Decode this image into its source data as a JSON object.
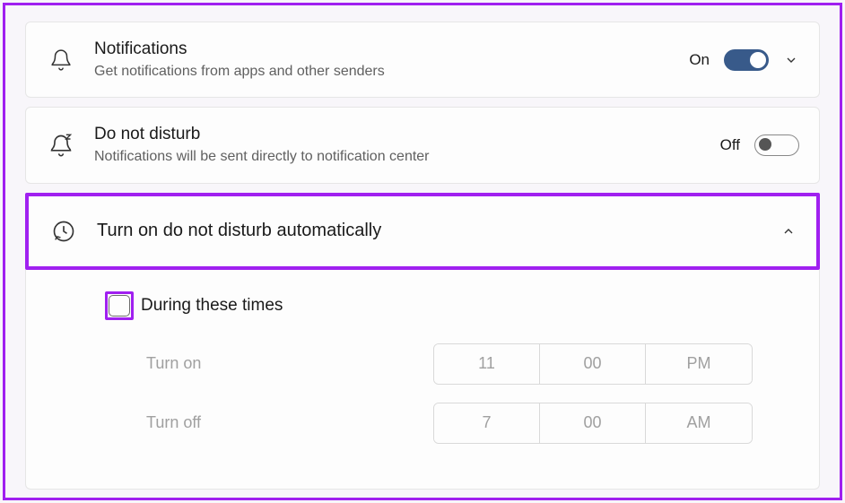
{
  "notifications": {
    "title": "Notifications",
    "subtitle": "Get notifications from apps and other senders",
    "state": "On"
  },
  "dnd": {
    "title": "Do not disturb",
    "subtitle": "Notifications will be sent directly to notification center",
    "state": "Off"
  },
  "auto_dnd": {
    "title": "Turn on do not disturb automatically",
    "during_label": "During these times",
    "turn_on": {
      "label": "Turn on",
      "hour": "11",
      "minute": "00",
      "ampm": "PM"
    },
    "turn_off": {
      "label": "Turn off",
      "hour": "7",
      "minute": "00",
      "ampm": "AM"
    }
  }
}
